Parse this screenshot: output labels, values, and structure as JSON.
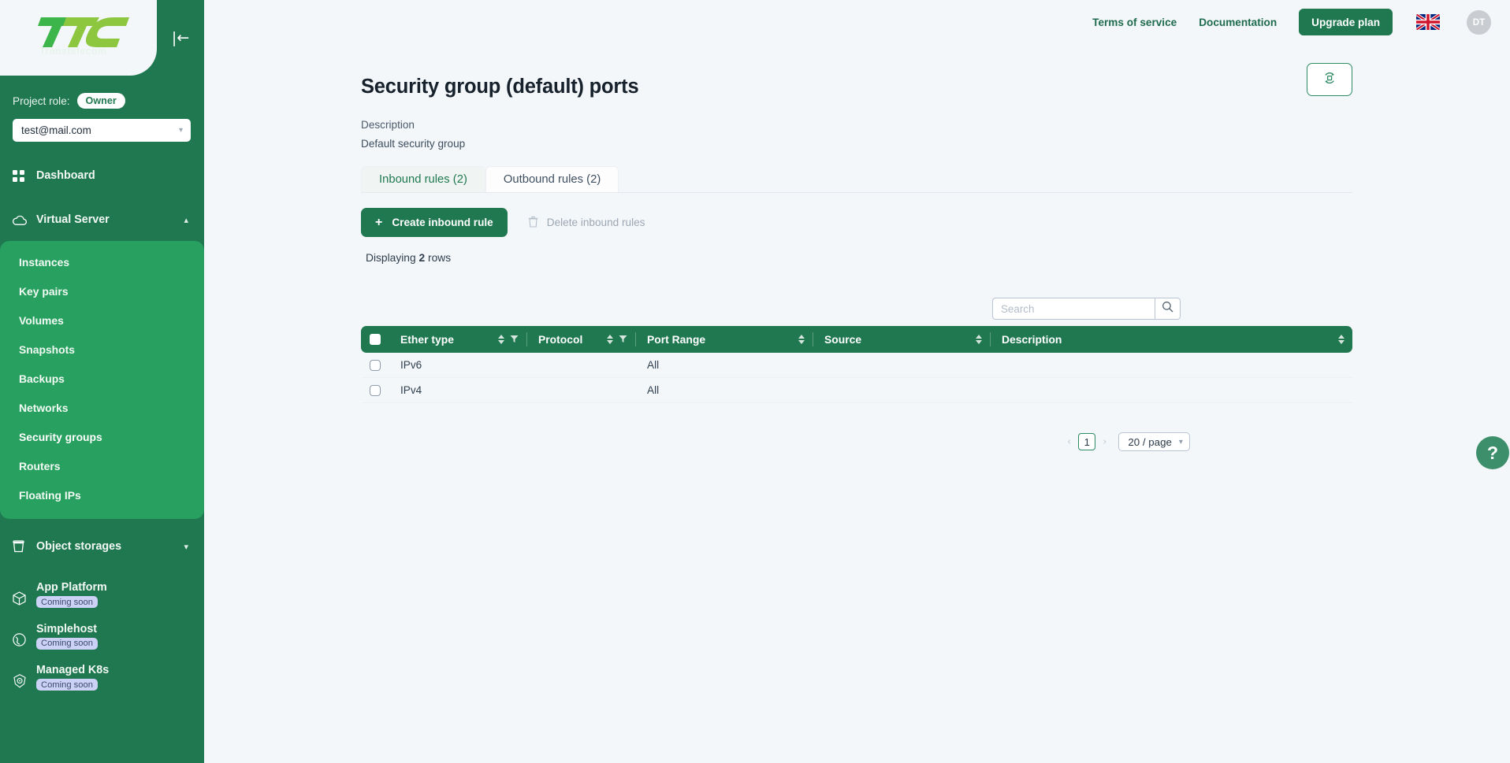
{
  "brand": {
    "logo_text": "TTC",
    "logo_subtitle": "Transtelecom",
    "accent": "#1f7850",
    "submenu_bg": "#28a05f"
  },
  "sidebar": {
    "collapse_icon": "collapse-left-icon",
    "role_label": "Project role:",
    "role_value": "Owner",
    "account": "test@mail.com",
    "items": [
      {
        "label": "Dashboard",
        "icon": "grid-icon"
      },
      {
        "label": "Virtual Server",
        "icon": "cloud-icon",
        "expanded": true
      }
    ],
    "virtual_server_children": [
      {
        "label": "Instances"
      },
      {
        "label": "Key pairs"
      },
      {
        "label": "Volumes"
      },
      {
        "label": "Snapshots"
      },
      {
        "label": "Backups"
      },
      {
        "label": "Networks"
      },
      {
        "label": "Security groups"
      },
      {
        "label": "Routers"
      },
      {
        "label": "Floating IPs"
      }
    ],
    "object_storages": {
      "label": "Object storages",
      "icon": "bucket-icon"
    },
    "coming_soon_items": [
      {
        "label": "App Platform",
        "badge": "Coming soon",
        "icon": "cube-icon"
      },
      {
        "label": "Simplehost",
        "badge": "Coming soon",
        "icon": "globe-icon"
      },
      {
        "label": "Managed K8s",
        "badge": "Coming soon",
        "icon": "kubernetes-icon"
      }
    ]
  },
  "topbar": {
    "links": [
      "Terms of service",
      "Documentation"
    ],
    "upgrade_label": "Upgrade plan",
    "flag": "uk-flag-icon",
    "avatar_initials": "DT"
  },
  "main": {
    "title": "Security group (default) ports",
    "refresh_icon": "refresh-sync-icon",
    "description_label": "Description",
    "description_value": "Default security group",
    "tabs": [
      {
        "label": "Inbound rules (2)",
        "active": true
      },
      {
        "label": "Outbound rules (2)",
        "active": false
      }
    ],
    "create_label": "Create inbound rule",
    "delete_label": "Delete inbound rules",
    "displaying_prefix": "Displaying ",
    "displaying_count": "2",
    "displaying_suffix": " rows",
    "search": {
      "placeholder": "Search",
      "value": "",
      "icon": "search-icon"
    }
  },
  "table": {
    "columns": [
      {
        "label": "Ether type",
        "sortable": true,
        "filterable": true
      },
      {
        "label": "Protocol",
        "sortable": true,
        "filterable": true
      },
      {
        "label": "Port Range",
        "sortable": true,
        "filterable": false
      },
      {
        "label": "Source",
        "sortable": true,
        "filterable": false
      },
      {
        "label": "Description",
        "sortable": true,
        "filterable": false
      }
    ],
    "rows": [
      {
        "ether_type": "IPv6",
        "protocol": "",
        "port_range": "All",
        "source": "",
        "description": ""
      },
      {
        "ether_type": "IPv4",
        "protocol": "",
        "port_range": "All",
        "source": "",
        "description": ""
      }
    ]
  },
  "pagination": {
    "prev": "‹",
    "next": "›",
    "current_page": "1",
    "page_size": "20 / page"
  },
  "help": {
    "label": "?"
  }
}
